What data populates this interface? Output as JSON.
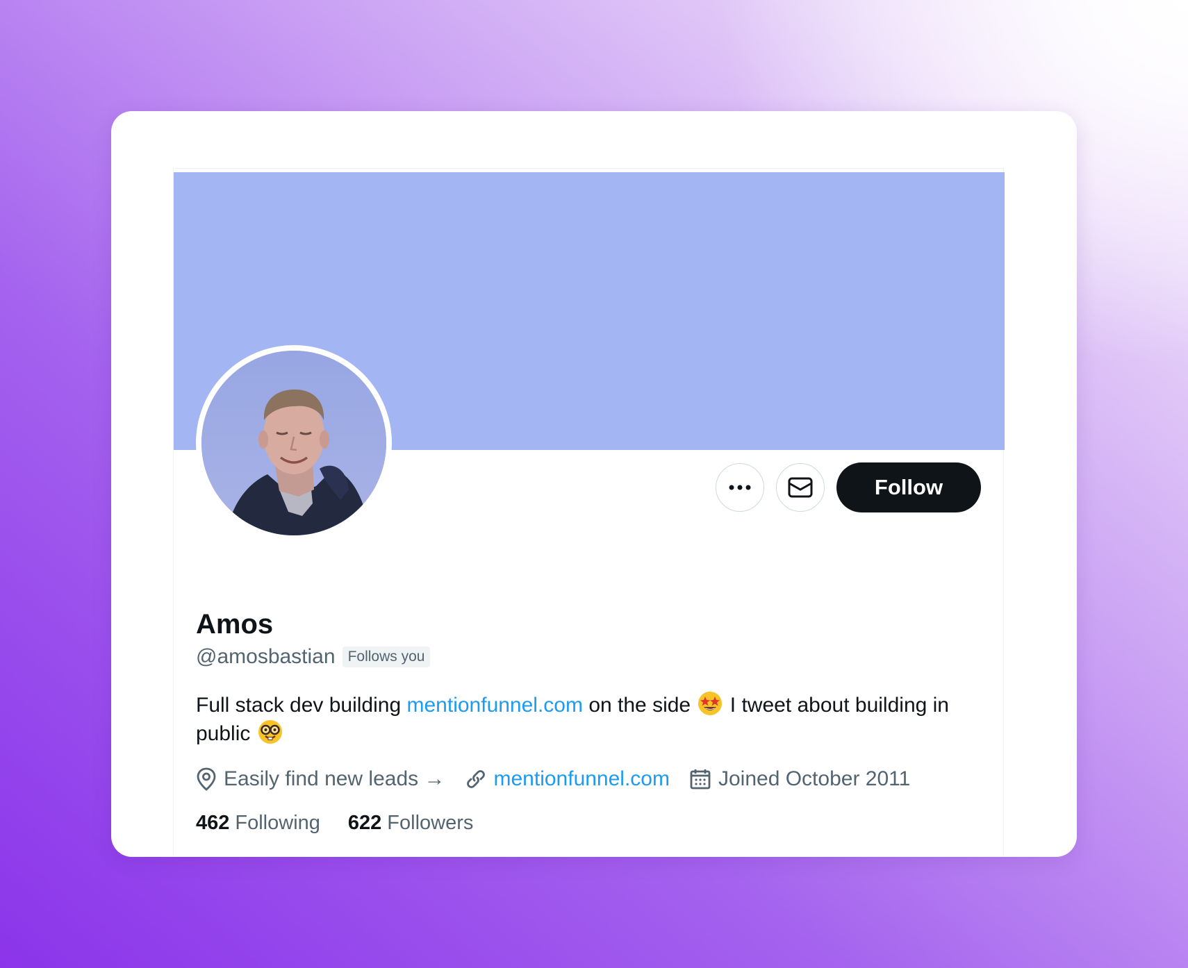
{
  "profile": {
    "name": "Amos",
    "handle": "@amosbastian",
    "follows_you": "Follows you",
    "bio": {
      "part1": "Full stack dev building ",
      "link": "mentionfunnel.com",
      "part2": " on the side ",
      "part3": " I tweet about building in public "
    },
    "location": "Easily find new leads →",
    "website": "mentionfunnel.com",
    "joined": "Joined October 2011",
    "following_count": "462",
    "following_label": "Following",
    "followers_count": "622",
    "followers_label": "Followers"
  },
  "actions": {
    "follow_label": "Follow"
  },
  "colors": {
    "banner": "#a3b6f3",
    "link": "#1d9bf0",
    "text": "#0f1419",
    "secondary": "#536471",
    "follow_button": "#0f1419"
  },
  "icons": {
    "more": "more-horizontal-icon",
    "message": "envelope-icon",
    "location": "location-pin-icon",
    "website": "link-icon",
    "joined": "calendar-icon",
    "emoji_1": "star-struck-emoji",
    "emoji_2": "nerd-face-emoji"
  }
}
